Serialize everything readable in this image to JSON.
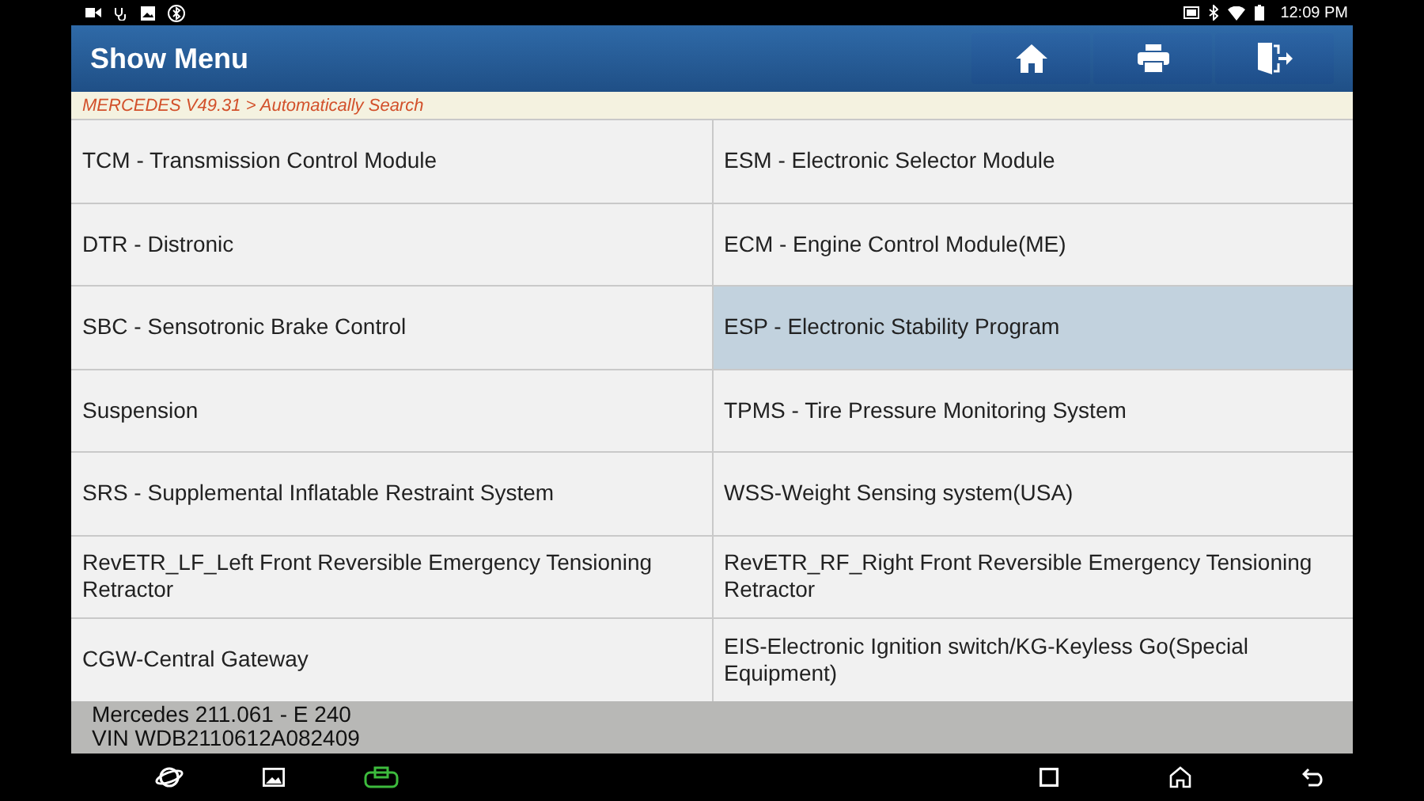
{
  "status_bar": {
    "time": "12:09 PM"
  },
  "header": {
    "title": "Show Menu"
  },
  "breadcrumb": "MERCEDES V49.31 > Automatically Search",
  "menu_items": [
    {
      "label": "TCM - Transmission Control Module",
      "selected": false
    },
    {
      "label": "ESM - Electronic Selector Module",
      "selected": false
    },
    {
      "label": "DTR - Distronic",
      "selected": false
    },
    {
      "label": "ECM - Engine Control Module(ME)",
      "selected": false
    },
    {
      "label": "SBC - Sensotronic Brake Control",
      "selected": false
    },
    {
      "label": "ESP - Electronic Stability Program",
      "selected": true
    },
    {
      "label": "Suspension",
      "selected": false
    },
    {
      "label": "TPMS - Tire Pressure Monitoring System",
      "selected": false
    },
    {
      "label": "SRS - Supplemental Inflatable Restraint System",
      "selected": false
    },
    {
      "label": "WSS-Weight Sensing system(USA)",
      "selected": false
    },
    {
      "label": "RevETR_LF_Left Front Reversible Emergency Tensioning Retractor",
      "selected": false
    },
    {
      "label": "RevETR_RF_Right Front Reversible Emergency Tensioning Retractor",
      "selected": false
    },
    {
      "label": "CGW-Central Gateway",
      "selected": false
    },
    {
      "label": "EIS-Electronic Ignition switch/KG-Keyless Go(Special Equipment)",
      "selected": false
    }
  ],
  "vehicle_info": {
    "model": "Mercedes 211.061 - E 240",
    "vin": "VIN WDB2110612A082409"
  }
}
